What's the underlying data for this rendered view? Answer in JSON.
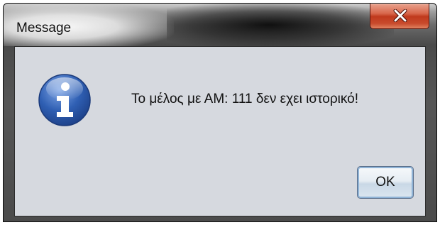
{
  "window": {
    "title": "Message"
  },
  "titlebar": {
    "close_icon": "close-icon"
  },
  "dialog": {
    "icon": "info-icon",
    "message": "Το μέλος με ΑΜ: 111 δεν εχει ιστορικό!",
    "ok_label": "OK"
  },
  "colors": {
    "client_background": "#d6d9df",
    "close_button": "#c03a1d",
    "info_icon_blue": "#2f5fb3",
    "ok_button_border": "#5a6e8a"
  }
}
